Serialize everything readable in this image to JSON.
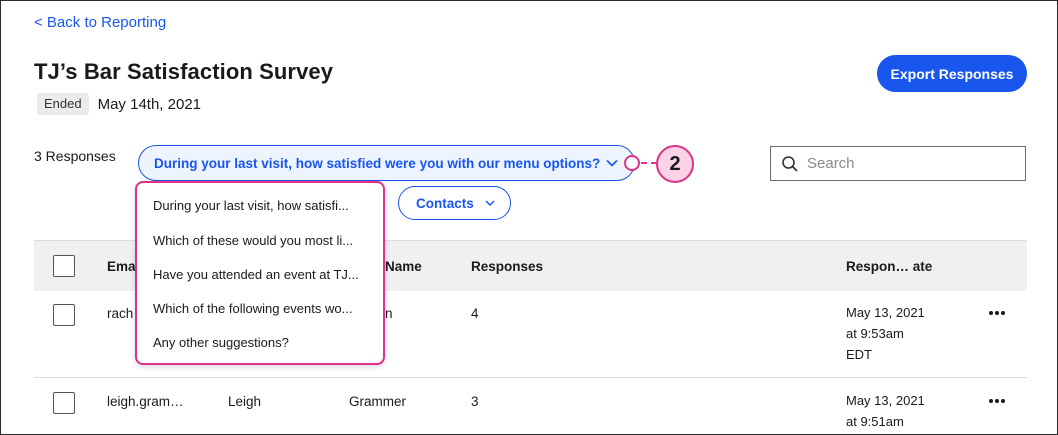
{
  "nav": {
    "back_label": "< Back to Reporting"
  },
  "survey": {
    "title": "TJ’s Bar Satisfaction Survey",
    "status": "Ended",
    "date": "May 14th, 2021"
  },
  "toolbar": {
    "export_label": "Export Responses",
    "responses_count": "3 Responses",
    "question_selected": "During your last visit, how satisfied were you with our menu options?",
    "contacts_label": "Contacts",
    "search_placeholder": "Search"
  },
  "callout": {
    "number": "2"
  },
  "dropdown": {
    "items": [
      "During your last visit, how satisfi...",
      "Which of these would you most li...",
      "Have you attended an event at TJ...",
      "Which of the following events wo...",
      "Any other suggestions?"
    ]
  },
  "table": {
    "headers": [
      "Ema",
      "Name",
      "Responses",
      "Respon… ate"
    ],
    "rows": [
      {
        "email": "rach",
        "first": "",
        "last": "n",
        "responses": "4",
        "date": "May 13, 2021",
        "time": "at 9:53am",
        "tz": "EDT"
      },
      {
        "email": "leigh.gram…",
        "first": "Leigh",
        "last": "Grammer",
        "responses": "3",
        "date": "May 13, 2021",
        "time": "at 9:51am",
        "tz": ""
      }
    ]
  },
  "colors": {
    "accent": "#1856ed",
    "callout": "#e0318a",
    "callout_fill": "#fbd2e6"
  },
  "icons": {
    "search": "search-icon",
    "chevron": "chevron-down-icon",
    "more": "more-horizontal-icon"
  }
}
